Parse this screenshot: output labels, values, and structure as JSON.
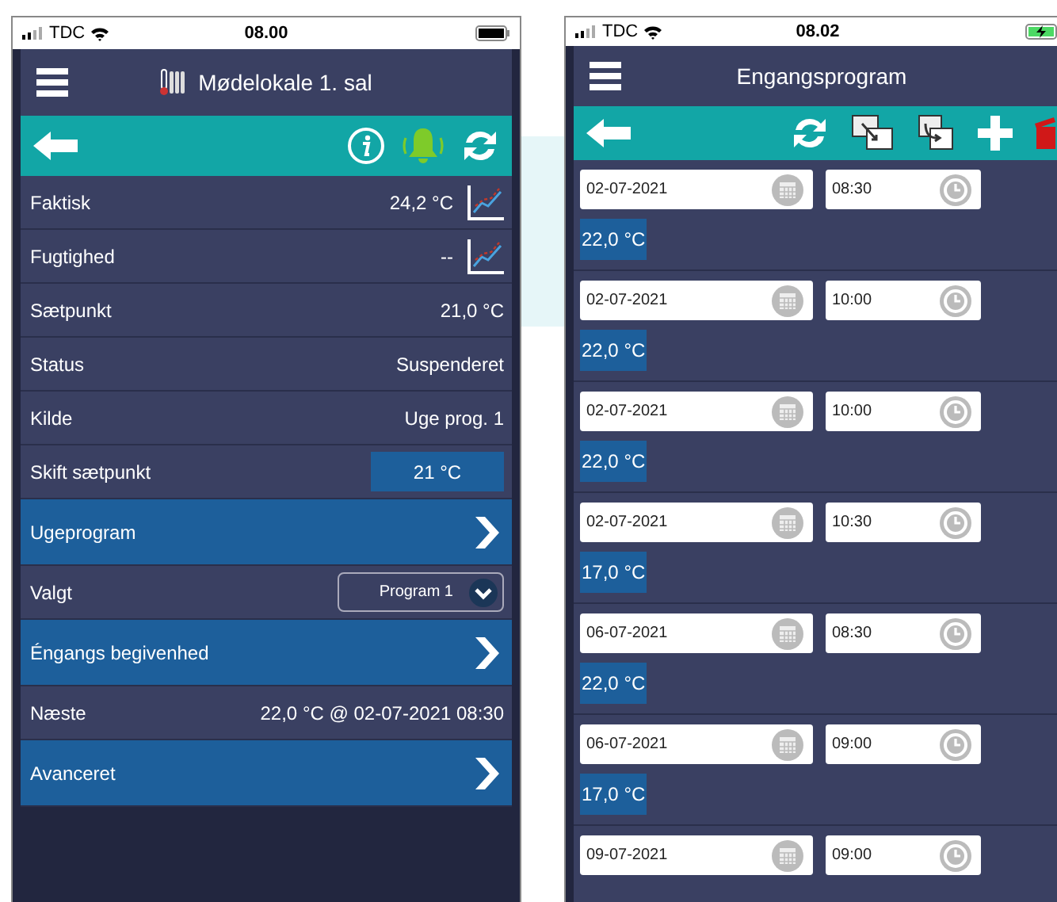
{
  "phones": [
    {
      "status_bar": {
        "carrier": "TDC",
        "time": "08.00",
        "charging": false
      },
      "header": {
        "title": "Mødelokale 1. sal",
        "room_icon": true
      },
      "toolbar": {
        "tools": [
          {
            "kind": "info"
          },
          {
            "kind": "bell"
          },
          {
            "kind": "refresh"
          }
        ]
      },
      "rows": [
        {
          "kind": "info",
          "label": "Faktisk",
          "value": "24,2 °C",
          "chart": true
        },
        {
          "kind": "info",
          "label": "Fugtighed",
          "value": "--",
          "chart": true
        },
        {
          "kind": "info",
          "label": "Sætpunkt",
          "value": "21,0 °C",
          "chart": false
        },
        {
          "kind": "info",
          "label": "Status",
          "value": "Suspenderet",
          "chart": false
        },
        {
          "kind": "info",
          "label": "Kilde",
          "value": "Uge prog. 1",
          "chart": false
        },
        {
          "kind": "input",
          "label": "Skift sætpunkt",
          "value": "21 °C"
        },
        {
          "kind": "nav",
          "label": "Ugeprogram"
        },
        {
          "kind": "select",
          "label": "Valgt",
          "value": "Program 1"
        },
        {
          "kind": "nav",
          "label": "Éngangs begivenhed"
        },
        {
          "kind": "info",
          "label": "Næste",
          "value": "22,0 °C @ 02-07-2021 08:30",
          "chart": false
        },
        {
          "kind": "nav",
          "label": "Avanceret"
        }
      ]
    },
    {
      "status_bar": {
        "carrier": "TDC",
        "time": "08.02",
        "charging": true
      },
      "header": {
        "title": "Engangsprogram",
        "room_icon": false
      },
      "toolbar": {
        "tools": [
          {
            "kind": "refresh"
          },
          {
            "kind": "copy"
          },
          {
            "kind": "paste"
          },
          {
            "kind": "add"
          },
          {
            "kind": "delete"
          }
        ]
      },
      "events": [
        {
          "date": "02-07-2021",
          "time": "08:30",
          "temp": "22,0 °C"
        },
        {
          "date": "02-07-2021",
          "time": "10:00",
          "temp": "22,0 °C"
        },
        {
          "date": "02-07-2021",
          "time": "10:00",
          "temp": "22,0 °C"
        },
        {
          "date": "02-07-2021",
          "time": "10:30",
          "temp": "17,0 °C"
        },
        {
          "date": "06-07-2021",
          "time": "08:30",
          "temp": "22,0 °C"
        },
        {
          "date": "06-07-2021",
          "time": "09:00",
          "temp": "17,0 °C"
        },
        {
          "date": "09-07-2021",
          "time": "09:00"
        }
      ]
    }
  ]
}
